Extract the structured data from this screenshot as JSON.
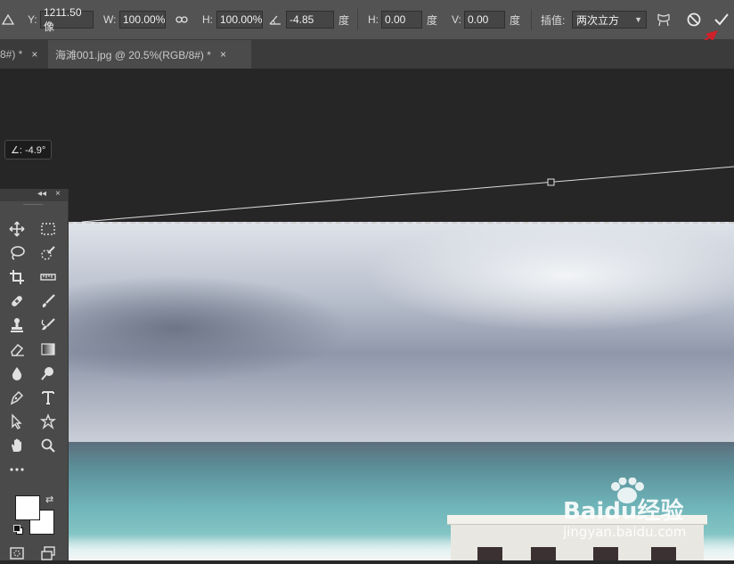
{
  "options_bar": {
    "y_label": "Y:",
    "y_value": "1211.50 像",
    "w_label": "W:",
    "w_value": "100.00%",
    "h_label": "H:",
    "h_value": "100.00%",
    "angle_value": "-4.85",
    "angle_unit": "度",
    "hskew_label": "H:",
    "hskew_value": "0.00",
    "hskew_unit": "度",
    "vskew_label": "V:",
    "vskew_value": "0.00",
    "vskew_unit": "度",
    "interp_label": "插值:",
    "interp_value": "两次立方",
    "icons": [
      "reference-point-icon",
      "link-icon",
      "angle-icon",
      "warp-icon",
      "cancel-transform-icon",
      "commit-transform-icon"
    ]
  },
  "tabs": [
    {
      "label": "8#) *",
      "close": "×"
    },
    {
      "label": "海滩001.jpg @ 20.5%(RGB/8#) *",
      "close": "×"
    }
  ],
  "angle_tooltip": "∠: -4.9°",
  "tool_panel": {
    "collapse": "◂◂",
    "close": "×"
  },
  "watermark": {
    "brand": "Baidu经验",
    "url": "jingyan.baidu.com"
  },
  "colors": {
    "annotation_arrow": "#d0202a",
    "foreground": "#ffffff",
    "background": "#ffffff"
  }
}
